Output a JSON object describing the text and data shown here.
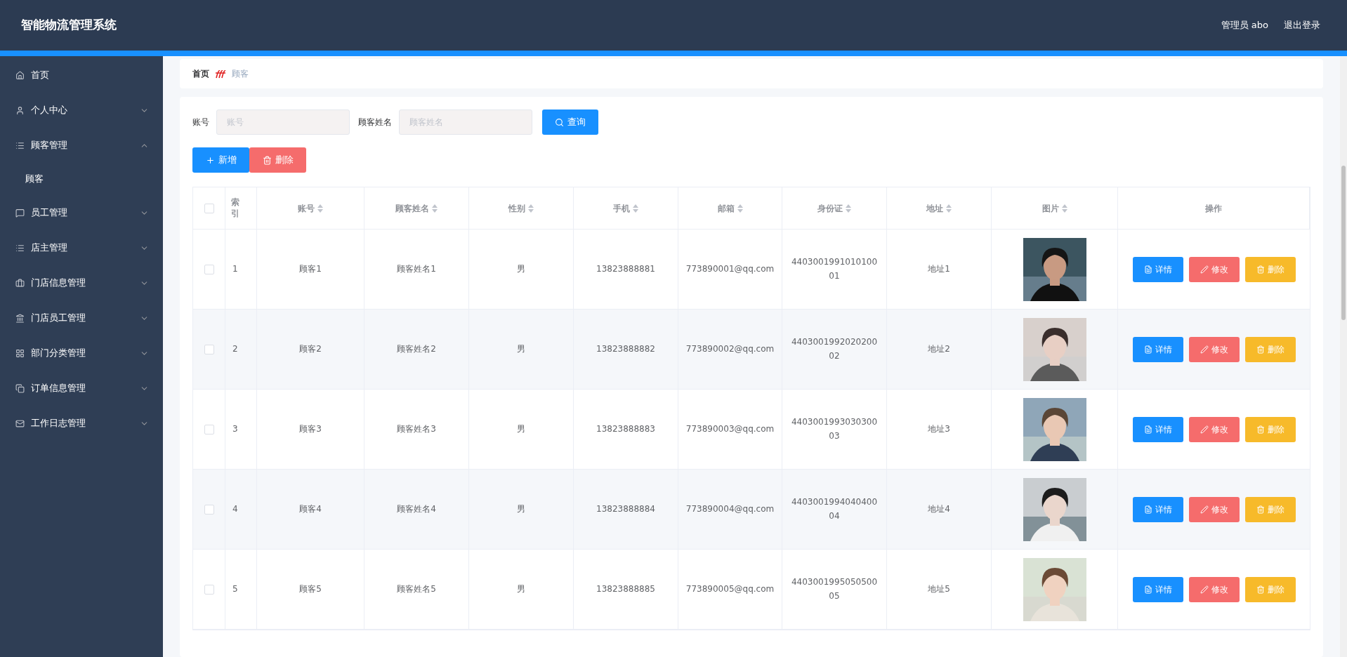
{
  "header": {
    "title": "智能物流管理系统",
    "user": "管理员 abo",
    "logout": "退出登录"
  },
  "sidebar": {
    "items": [
      {
        "label": "首页",
        "kind": "home",
        "has_children": false
      },
      {
        "label": "个人中心",
        "kind": "user",
        "expanded": false,
        "has_children": true
      },
      {
        "label": "顾客管理",
        "kind": "list",
        "expanded": true,
        "has_children": true,
        "children": [
          {
            "label": "顾客"
          }
        ]
      },
      {
        "label": "员工管理",
        "kind": "chat",
        "expanded": false,
        "has_children": true
      },
      {
        "label": "店主管理",
        "kind": "list",
        "expanded": false,
        "has_children": true
      },
      {
        "label": "门店信息管理",
        "kind": "case",
        "expanded": false,
        "has_children": true
      },
      {
        "label": "门店员工管理",
        "kind": "house",
        "expanded": false,
        "has_children": true
      },
      {
        "label": "部门分类管理",
        "kind": "grid",
        "expanded": false,
        "has_children": true
      },
      {
        "label": "订单信息管理",
        "kind": "copy",
        "expanded": false,
        "has_children": true
      },
      {
        "label": "工作日志管理",
        "kind": "mail",
        "expanded": false,
        "has_children": true
      }
    ]
  },
  "breadcrumb": [
    {
      "label": "首页",
      "selected": false
    },
    {
      "label": "顾客",
      "selected": true
    }
  ],
  "search": {
    "fields": [
      {
        "label": "账号",
        "placeholder": "账号"
      },
      {
        "label": "顾客姓名",
        "placeholder": "顾客姓名"
      }
    ],
    "button": "查询"
  },
  "toolbar": [
    {
      "label": "新增",
      "kind": "add"
    },
    {
      "label": "删除",
      "kind": "delete"
    }
  ],
  "table": {
    "header_checked": false,
    "columns": [
      {
        "label": "索引",
        "sortable": false
      },
      {
        "label": "账号",
        "sortable": true
      },
      {
        "label": "顾客姓名",
        "sortable": true
      },
      {
        "label": "性别",
        "sortable": true
      },
      {
        "label": "手机",
        "sortable": true
      },
      {
        "label": "邮箱",
        "sortable": true
      },
      {
        "label": "身份证",
        "sortable": true
      },
      {
        "label": "地址",
        "sortable": true
      },
      {
        "label": "图片",
        "sortable": true
      },
      {
        "label": "操作",
        "sortable": false
      }
    ],
    "rows": [
      {
        "checked": false,
        "cells": [
          "1",
          "顾客1",
          "顾客姓名1",
          "男",
          "13823888881",
          "773890001@qq.com",
          "440300199101010001",
          "地址1"
        ],
        "actions": [
          {
            "label": "详情",
            "kind": "detail"
          },
          {
            "label": "修改",
            "kind": "edit"
          },
          {
            "label": "删除",
            "kind": "delete"
          }
        ]
      },
      {
        "checked": false,
        "cells": [
          "2",
          "顾客2",
          "顾客姓名2",
          "男",
          "13823888882",
          "773890002@qq.com",
          "440300199202020002",
          "地址2"
        ],
        "actions": [
          {
            "label": "详情",
            "kind": "detail"
          },
          {
            "label": "修改",
            "kind": "edit"
          },
          {
            "label": "删除",
            "kind": "delete"
          }
        ]
      },
      {
        "checked": false,
        "cells": [
          "3",
          "顾客3",
          "顾客姓名3",
          "男",
          "13823888883",
          "773890003@qq.com",
          "440300199303030003",
          "地址3"
        ],
        "actions": [
          {
            "label": "详情",
            "kind": "detail"
          },
          {
            "label": "修改",
            "kind": "edit"
          },
          {
            "label": "删除",
            "kind": "delete"
          }
        ]
      },
      {
        "checked": false,
        "cells": [
          "4",
          "顾客4",
          "顾客姓名4",
          "男",
          "13823888884",
          "773890004@qq.com",
          "440300199404040004",
          "地址4"
        ],
        "actions": [
          {
            "label": "详情",
            "kind": "detail"
          },
          {
            "label": "修改",
            "kind": "edit"
          },
          {
            "label": "删除",
            "kind": "delete"
          }
        ]
      },
      {
        "checked": false,
        "cells": [
          "5",
          "顾客5",
          "顾客姓名5",
          "男",
          "13823888885",
          "773890005@qq.com",
          "440300199505050005",
          "地址5"
        ],
        "actions": [
          {
            "label": "详情",
            "kind": "detail"
          },
          {
            "label": "修改",
            "kind": "edit"
          },
          {
            "label": "删除",
            "kind": "delete"
          }
        ]
      }
    ]
  }
}
